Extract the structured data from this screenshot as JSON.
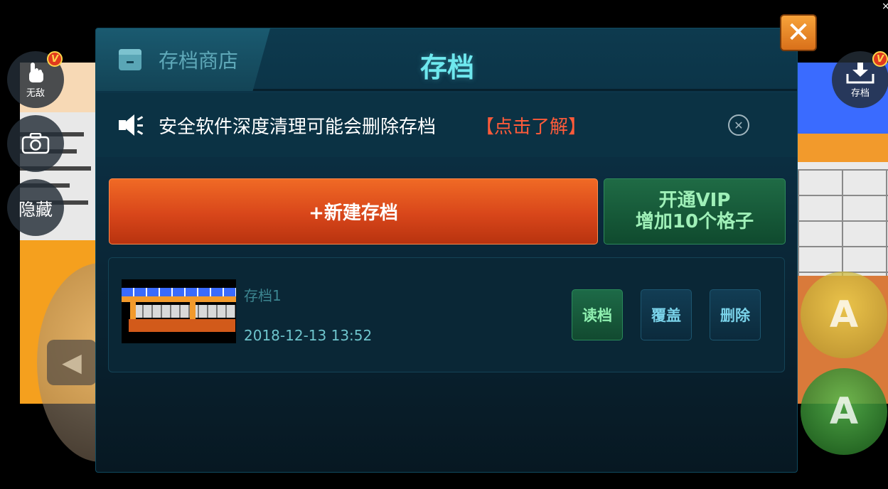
{
  "side_controls": {
    "invincible_label": "无敌",
    "hide_label": "隐藏",
    "save_label": "存档",
    "vip_badge": "V"
  },
  "game_buttons": {
    "a_top": "A",
    "a_bottom": "A",
    "dpad_left": "◀"
  },
  "window": {
    "close_glyph": "×"
  },
  "dialog": {
    "close_glyph": "✕",
    "tabs": {
      "shop": "存档商店",
      "save": "存档"
    },
    "notice": {
      "text": "安全软件深度清理可能会删除存档",
      "link": "【点击了解】",
      "close_glyph": "✕"
    },
    "new_save_button": "+新建存档",
    "vip_button": {
      "line1": "开通VIP",
      "line2": "增加10个格子"
    },
    "saves": [
      {
        "name": "存档1",
        "time": "2018-12-13 13:52",
        "actions": {
          "load": "读档",
          "overwrite": "覆盖",
          "delete": "删除"
        }
      }
    ]
  },
  "colors": {
    "accent_title": "#6ee8ee",
    "new_save": "#d8461a",
    "vip": "#1f6b45",
    "link": "#ff5b3a",
    "close": "#f7a33a"
  }
}
